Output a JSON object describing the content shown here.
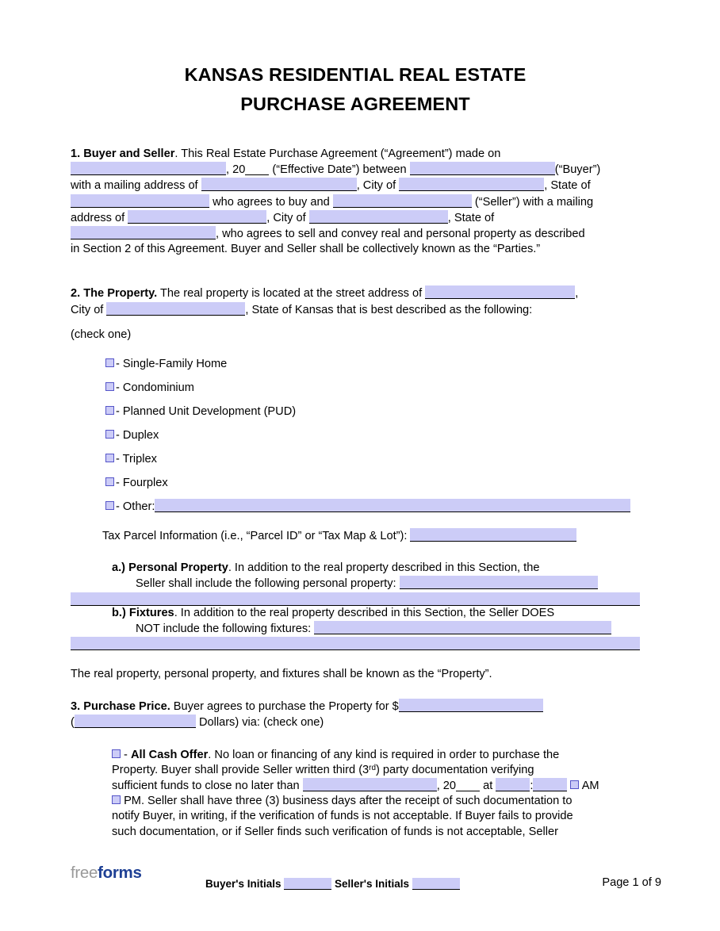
{
  "document": {
    "title_line1": "KANSAS RESIDENTIAL REAL ESTATE",
    "title_line2": "PURCHASE AGREEMENT"
  },
  "section1": {
    "heading": "1. Buyer and Seller",
    "t1": ". This Real Estate Purchase Agreement (“Agreement”) made on",
    "t2": ", 20",
    "t3": "(“Effective Date”) between",
    "t4": "(“Buyer”)",
    "t5": "with a mailing address of",
    "t6": ", City of",
    "t7": ", State of",
    "t8": "who agrees to buy and",
    "t9": "(“Seller”) with a mailing",
    "t10": "address of",
    "t11": ", City of",
    "t12": ", State of",
    "t13": ", who agrees to sell and convey real and personal property as described",
    "t14": "in Section 2 of this Agreement. Buyer and Seller shall be collectively known as the “Parties.”"
  },
  "section2": {
    "heading": "2. The Property.",
    "t1": " The real property is located at the street address of",
    "t2": ",",
    "t3": "City of",
    "t4": ", State of Kansas that is best described as the following:",
    "check_one": "(check one)",
    "options": [
      "- Single-Family Home",
      "- Condominium",
      "- Planned Unit Development (PUD)",
      "- Duplex",
      "- Triplex",
      "- Fourplex",
      "- Other:"
    ],
    "tax_parcel_label": "Tax Parcel Information (i.e., “Parcel ID” or “Tax Map & Lot”):",
    "a_marker": "a.)",
    "a_heading": "Personal Property",
    "a_text1": ". In addition to the real property described in this Section, the",
    "a_text2": "Seller shall include the following personal property:",
    "b_marker": "b.)",
    "b_heading": "Fixtures",
    "b_text1": ". In addition to the real property described in this Section, the Seller DOES",
    "b_text2": "NOT include the following fixtures:",
    "closing": "The real property, personal property, and fixtures shall be known as the “Property”."
  },
  "section3": {
    "heading": "3. Purchase Price.",
    "t1": " Buyer agrees to purchase the Property for $",
    "t2": "(",
    "t3": "Dollars) via: (check one)",
    "cash": {
      "label": "All Cash Offer",
      "p1": ". No loan or financing of any kind is required in order to purchase the",
      "p2a": "Property. Buyer shall provide Seller written third (3",
      "p2sup": "rd",
      "p2b": ") party documentation verifying",
      "p3a": "sufficient funds to close no later than",
      "p3b": ", 20",
      "p3c": "at",
      "p3d": ":",
      "p3e": "AM",
      "p4": "PM. Seller shall have three (3) business days after the receipt of such documentation to",
      "p5": "notify Buyer, in writing, if the verification of funds is not acceptable. If Buyer fails to provide",
      "p6": "such documentation, or if Seller finds such verification of funds is not acceptable, Seller"
    }
  },
  "footer": {
    "logo_part1": "free",
    "logo_part2": "forms",
    "buyer_initials_label": "Buyer's Initials",
    "seller_initials_label": "Seller's Initials",
    "page_label": "Page 1 of 9"
  },
  "colors": {
    "field_fill": "#ccccf7",
    "checkbox_border": "#5555c9",
    "logo_gray": "#9a9a9a",
    "logo_blue": "#1d3f94"
  }
}
